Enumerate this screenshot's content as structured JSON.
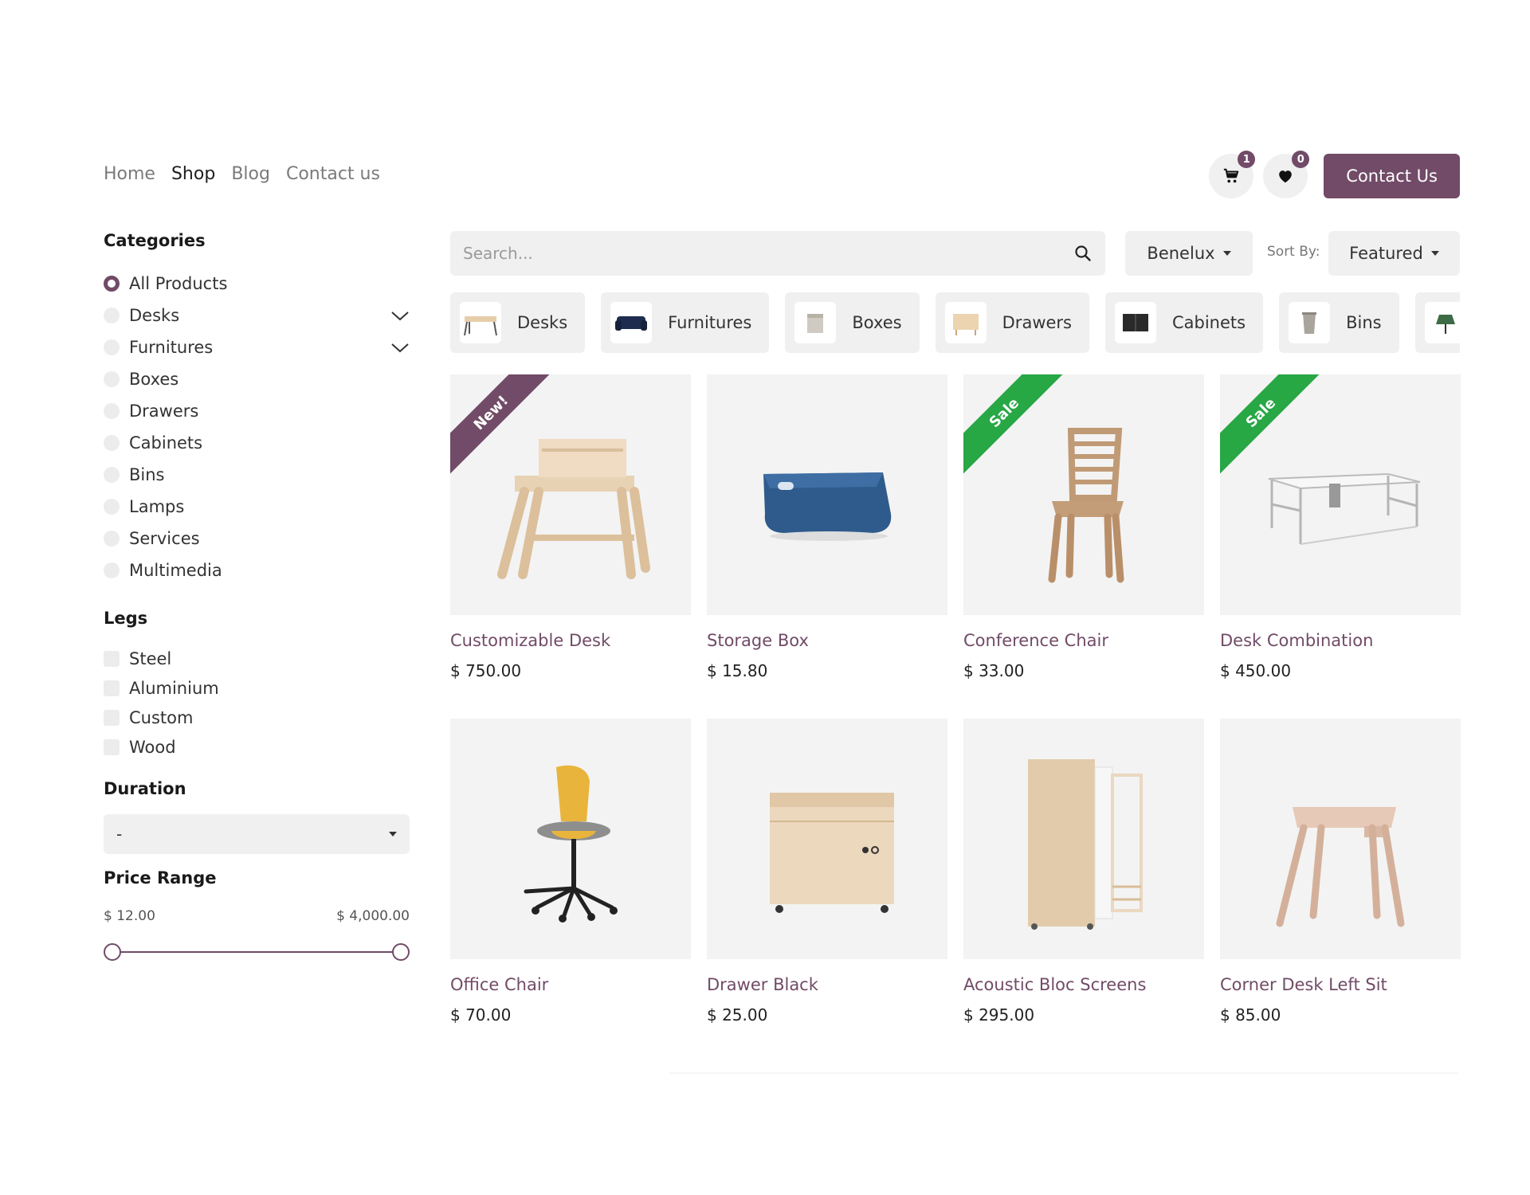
{
  "nav": {
    "home": "Home",
    "shop": "Shop",
    "blog": "Blog",
    "contact": "Contact us"
  },
  "header": {
    "cart_count": "1",
    "wishlist_count": "0",
    "cta_label": "Contact Us",
    "accent": "#714b67"
  },
  "sidebar": {
    "categories_title": "Categories",
    "categories": [
      "All Products",
      "Desks",
      "Furnitures",
      "Boxes",
      "Drawers",
      "Cabinets",
      "Bins",
      "Lamps",
      "Services",
      "Multimedia"
    ],
    "legs_title": "Legs",
    "legs": [
      "Steel",
      "Aluminium",
      "Custom",
      "Wood"
    ],
    "duration_title": "Duration",
    "duration_value": "-",
    "price_title": "Price Range",
    "price_min": "$ 12.00",
    "price_max": "$ 4,000.00"
  },
  "toolbar": {
    "search_placeholder": "Search...",
    "pricelist": "Benelux",
    "sort_label": "Sort By:",
    "sort_value": "Featured"
  },
  "chips": [
    "Desks",
    "Furnitures",
    "Boxes",
    "Drawers",
    "Cabinets",
    "Bins"
  ],
  "products": [
    {
      "name": "Customizable Desk",
      "price": "$ 750.00",
      "ribbon": "New!"
    },
    {
      "name": "Storage Box",
      "price": "$ 15.80",
      "ribbon": ""
    },
    {
      "name": "Conference Chair",
      "price": "$ 33.00",
      "ribbon": "Sale"
    },
    {
      "name": "Desk Combination",
      "price": "$ 450.00",
      "ribbon": "Sale"
    },
    {
      "name": "Office Chair",
      "price": "$ 70.00",
      "ribbon": ""
    },
    {
      "name": "Drawer Black",
      "price": "$ 25.00",
      "ribbon": ""
    },
    {
      "name": "Acoustic Bloc Screens",
      "price": "$ 295.00",
      "ribbon": ""
    },
    {
      "name": "Corner Desk Left Sit",
      "price": "$ 85.00",
      "ribbon": ""
    }
  ]
}
